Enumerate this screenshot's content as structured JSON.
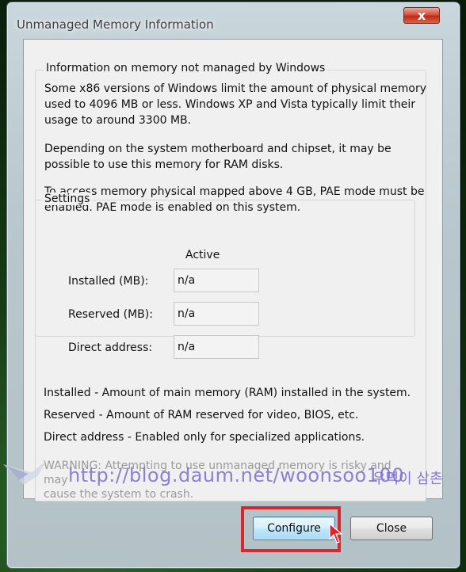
{
  "window": {
    "title": "Unmanaged Memory Information",
    "close_glyph": "x"
  },
  "info": {
    "group_title": "Information on memory not managed by Windows",
    "para1_line1": "Some x86 versions of Windows limit the amount of physical memory",
    "para1_line2": "used to 4096 MB or less. Windows XP and Vista typically limit their",
    "para1_line3": "usage to around 3300 MB.",
    "para2_line1": "Depending on the system motherboard and chipset, it may be",
    "para2_line2": "possible to use this memory for RAM disks.",
    "para3_line1": "To access memory physical mapped above 4 GB, PAE mode must be",
    "para3_line2": "enabled. PAE mode is enabled on this system."
  },
  "settings": {
    "title": "Settings",
    "column_header": "Active",
    "rows": [
      {
        "label": "Installed (MB):",
        "value": "n/a"
      },
      {
        "label": "Reserved (MB):",
        "value": "n/a"
      },
      {
        "label": "Direct address:",
        "value": "n/a"
      }
    ]
  },
  "definitions": {
    "installed": "Installed - Amount of main memory (RAM) installed in the system.",
    "reserved": "Reserved - Amount of RAM reserved for video, BIOS, etc.",
    "direct": "Direct address - Enabled only for specialized applications."
  },
  "warning": {
    "line1": "WARNING: Attempting to use unmanaged memory is risky and may",
    "line2": "cause the system to crash."
  },
  "watermark": {
    "url": "http://blog.daum.net/woonsoo100",
    "korean": "우먹이 삼촌"
  },
  "buttons": {
    "configure": "Configure",
    "close": "Close"
  },
  "colors": {
    "highlight": "#d9272e",
    "watermark": "#7b6cd0"
  }
}
